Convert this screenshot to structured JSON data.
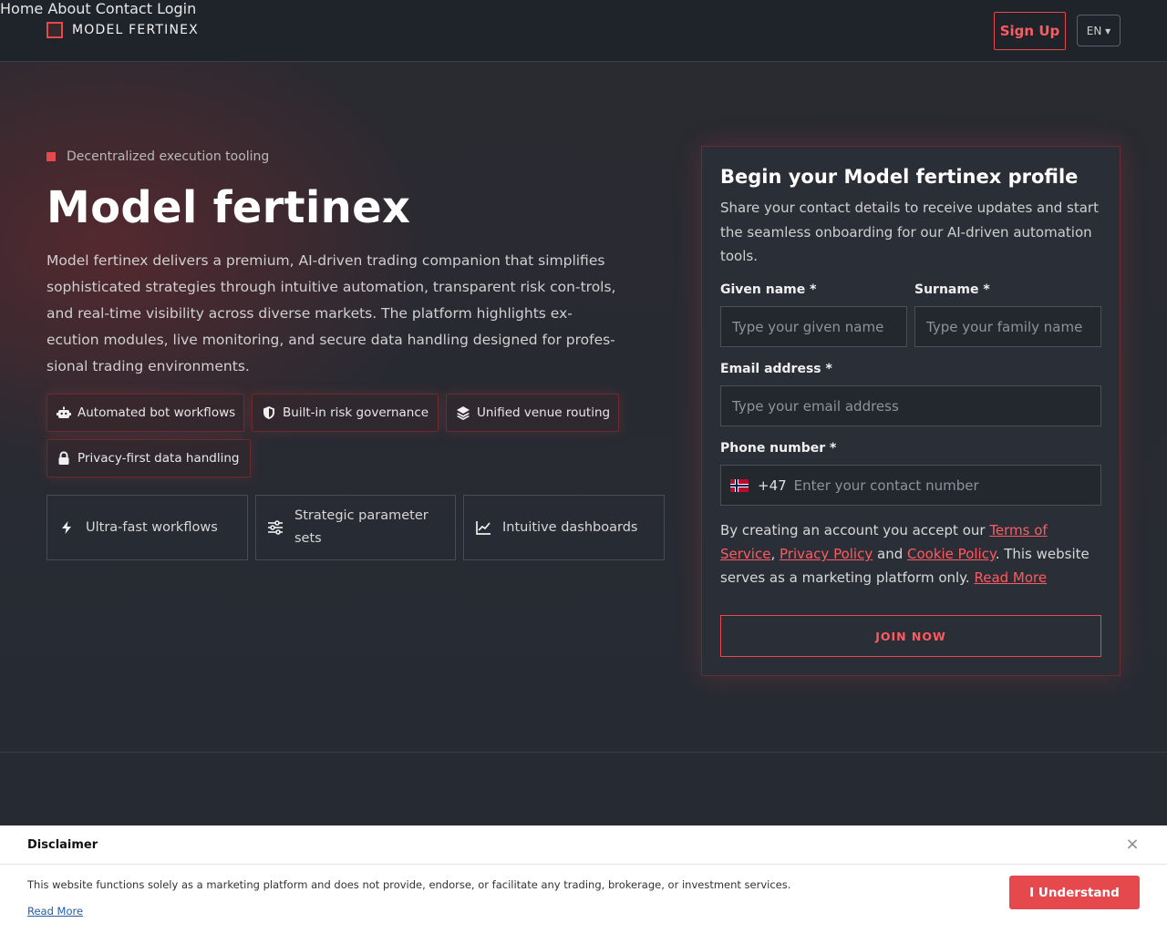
{
  "brand": {
    "name": "MODEL FERTINEX"
  },
  "nav": {
    "items": [
      "Home",
      "About",
      "Contact",
      "Login"
    ],
    "signup": "Sign Up",
    "language": "EN ▾"
  },
  "hero": {
    "tagline": "Decentralized execution tooling",
    "title": "Model fertinex",
    "description": "Model fertinex delivers a premium, AI-driven trading companion that simplifies sophisticated strategies through intuitive automation, transparent risk con-trols, and real-time visibility across diverse markets. The platform highlights ex-ecution modules, live monitoring, and secure data handling designed for profes-sional trading environments.",
    "chips": [
      {
        "icon": "robot-icon",
        "label": "Automated bot workflows"
      },
      {
        "icon": "shield-icon",
        "label": "Built-in risk governance"
      },
      {
        "icon": "layers-icon",
        "label": "Unified venue routing"
      },
      {
        "icon": "lock-icon",
        "label": "Privacy-first data handling"
      }
    ],
    "features": [
      {
        "icon": "bolt-icon",
        "label": "Ultra-fast workflows"
      },
      {
        "icon": "sliders-icon",
        "label": "Strategic parameter sets"
      },
      {
        "icon": "chart-line-icon",
        "label": "Intuitive dashboards"
      }
    ]
  },
  "form": {
    "title": "Begin your Model fertinex profile",
    "subtitle": "Share your contact details to receive updates and start the seamless onboarding for our AI-driven automation tools.",
    "given_name": {
      "label": "Given name *",
      "placeholder": "Type your given name",
      "value": ""
    },
    "surname": {
      "label": "Surname *",
      "placeholder": "Type your family name",
      "value": ""
    },
    "email": {
      "label": "Email address *",
      "placeholder": "Type your email address",
      "value": ""
    },
    "phone": {
      "label": "Phone number *",
      "country_code": "+47",
      "flag": "norway-flag-icon",
      "placeholder": "Enter your contact number",
      "value": ""
    },
    "terms": {
      "prefix": "By creating an account you accept our ",
      "tos": "Terms of Service",
      "comma": ",",
      "privacy": "Privacy Policy",
      "and": " and ",
      "cookie": "Cookie Policy",
      "suffix": ". This website serves as a marketing platform only. ",
      "read_more": "Read More"
    },
    "submit": "JOIN NOW"
  },
  "disclaimer": {
    "title": "Disclaimer",
    "text": "This website functions solely as a marketing platform and does not provide, endorse, or facilitate any trading, brokerage, or investment services.",
    "link": "Read More",
    "button": "I Understand",
    "close": "×"
  },
  "colors": {
    "accent": "#e5484d",
    "background": "#262b33",
    "header": "#1f242b",
    "banner": "#ffffff"
  }
}
